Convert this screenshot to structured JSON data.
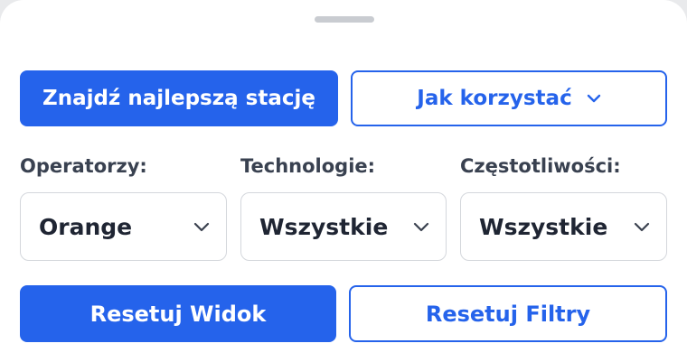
{
  "panel": {
    "find_best_station_label": "Znajdź najlepszą stację",
    "how_to_use_label": "Jak korzystać"
  },
  "filters": [
    {
      "label": "Operatorzy:",
      "value": "Orange"
    },
    {
      "label": "Technologie:",
      "value": "Wszystkie"
    },
    {
      "label": "Częstotliwości:",
      "value": "Wszystkie"
    }
  ],
  "actions": {
    "reset_view_label": "Resetuj Widok",
    "reset_filters_label": "Resetuj Filtry"
  },
  "colors": {
    "accent": "#2563eb",
    "text_dark": "#1f2533",
    "label_gray": "#394150",
    "border_gray": "#d4d7dc"
  },
  "icons": {
    "dropdown": "chevron-down-icon"
  }
}
